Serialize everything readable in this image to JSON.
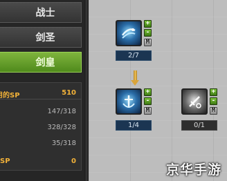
{
  "class_tabs": [
    {
      "label": "战士",
      "active": false
    },
    {
      "label": "剑圣",
      "active": false
    },
    {
      "label": "剑皇",
      "active": true
    }
  ],
  "sp_panel": {
    "rows": [
      {
        "label": "用的SP",
        "value": "510"
      },
      {
        "label": "",
        "value": "147/318"
      },
      {
        "label": "",
        "value": "328/328"
      },
      {
        "label": "",
        "value": "35/318"
      },
      {
        "label": "SP",
        "value": "0"
      }
    ]
  },
  "skills": [
    {
      "icon": "wind-slash-icon",
      "level": "2/7",
      "buttons": [
        "+",
        "-",
        "M"
      ]
    },
    {
      "icon": "anchor-strike-icon",
      "level": "1/4",
      "buttons": [
        "+",
        "-",
        "M"
      ]
    },
    {
      "icon": "locked-sword-icon",
      "level": "0/1",
      "buttons": [
        "+",
        "-",
        "M"
      ]
    }
  ],
  "watermark": "京华手游",
  "colors": {
    "active_tab": "#6aa52c",
    "sp_highlight": "#f2b239",
    "level_box": "#1b3552"
  }
}
